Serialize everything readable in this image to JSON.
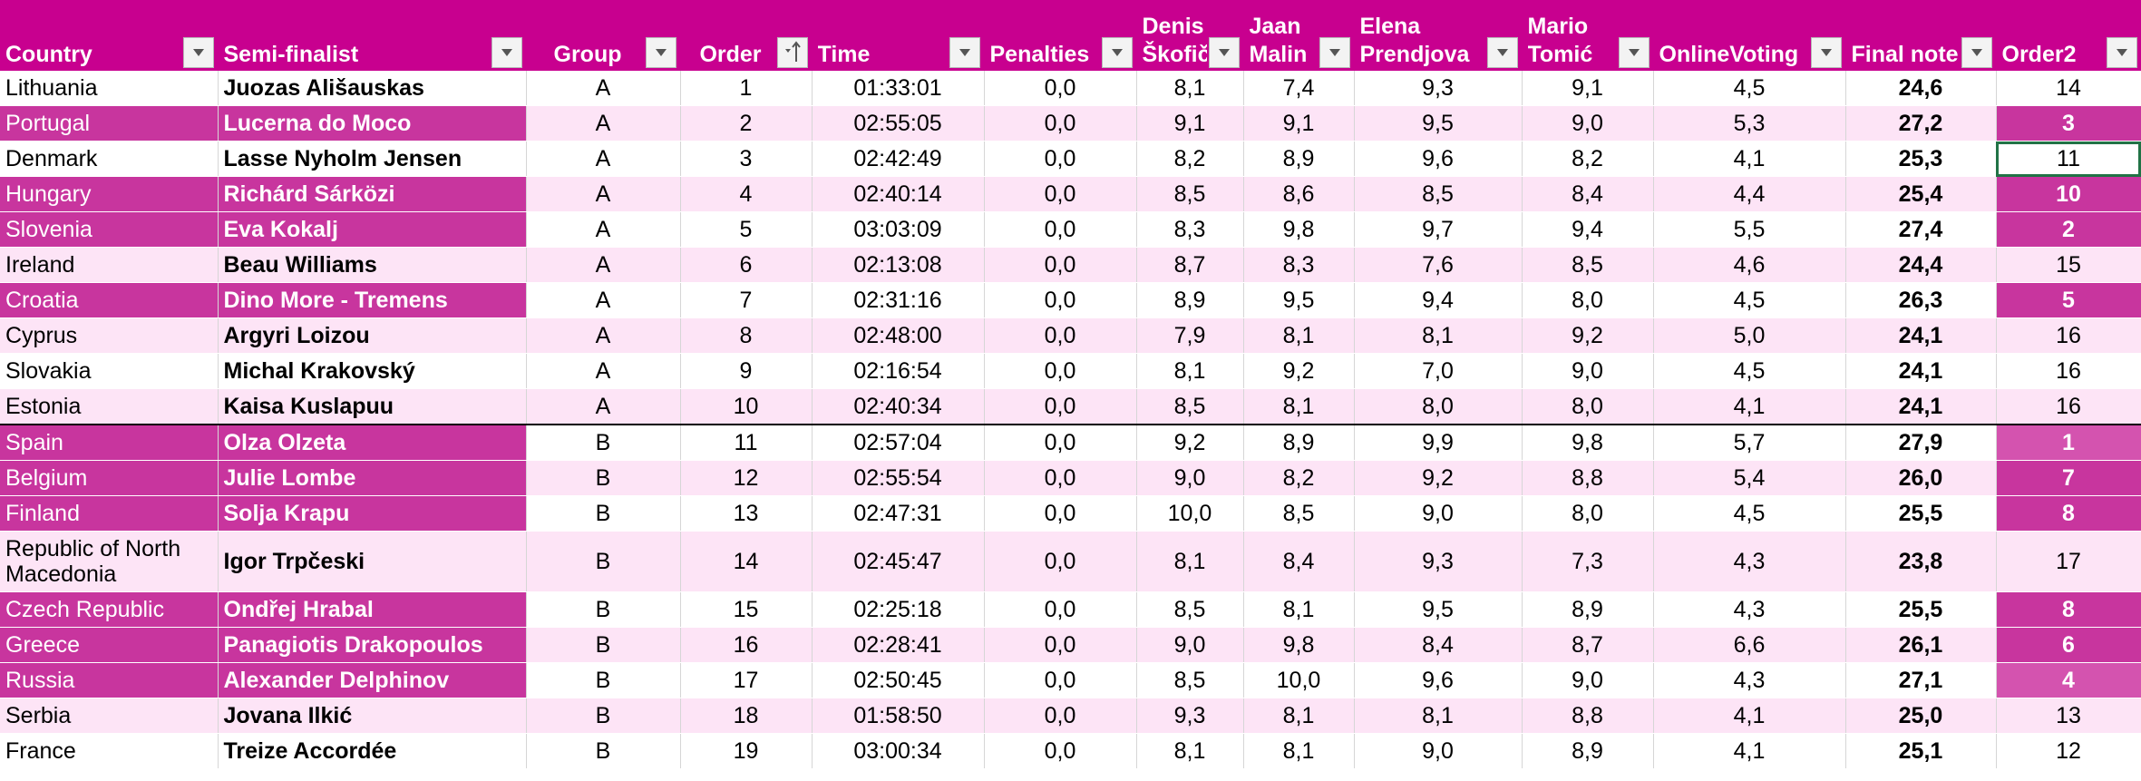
{
  "headers": [
    "Country",
    "Semi-finalist",
    "Group",
    "Order",
    "Time",
    "Penalties",
    "Denis Škofič",
    "Jaan Malin",
    "Elena Prendjova",
    "Mario Tomić",
    "OnlineVoting",
    "Final note",
    "Order2"
  ],
  "colors": {
    "header_bg": "#c8008f",
    "highlight": "#c8359e",
    "pale_row": "#fde4f6",
    "selection": "#217346"
  },
  "icons": {
    "filter": "filter-dropdown-icon",
    "sort": "sort-ascending-icon"
  },
  "rows": [
    {
      "country": "Lithuania",
      "name": "Juozas Ališauskas",
      "group": "A",
      "order": "1",
      "time": "01:33:01",
      "pen": "0,0",
      "j1": "8,1",
      "j2": "7,4",
      "j3": "9,3",
      "j4": "9,1",
      "online": "4,5",
      "final": "24,6",
      "order2": "14"
    },
    {
      "country": "Portugal",
      "name": "Lucerna do Moco",
      "group": "A",
      "order": "2",
      "time": "02:55:05",
      "pen": "0,0",
      "j1": "9,1",
      "j2": "9,1",
      "j3": "9,5",
      "j4": "9,0",
      "online": "5,3",
      "final": "27,2",
      "order2": "3"
    },
    {
      "country": "Denmark",
      "name": "Lasse Nyholm Jensen",
      "group": "A",
      "order": "3",
      "time": "02:42:49",
      "pen": "0,0",
      "j1": "8,2",
      "j2": "8,9",
      "j3": "9,6",
      "j4": "8,2",
      "online": "4,1",
      "final": "25,3",
      "order2": "11"
    },
    {
      "country": "Hungary",
      "name": "Richárd Sárközi",
      "group": "A",
      "order": "4",
      "time": "02:40:14",
      "pen": "0,0",
      "j1": "8,5",
      "j2": "8,6",
      "j3": "8,5",
      "j4": "8,4",
      "online": "4,4",
      "final": "25,4",
      "order2": "10"
    },
    {
      "country": "Slovenia",
      "name": "Eva Kokalj",
      "group": "A",
      "order": "5",
      "time": "03:03:09",
      "pen": "0,0",
      "j1": "8,3",
      "j2": "9,8",
      "j3": "9,7",
      "j4": "9,4",
      "online": "5,5",
      "final": "27,4",
      "order2": "2"
    },
    {
      "country": "Ireland",
      "name": "Beau Williams",
      "group": "A",
      "order": "6",
      "time": "02:13:08",
      "pen": "0,0",
      "j1": "8,7",
      "j2": "8,3",
      "j3": "7,6",
      "j4": "8,5",
      "online": "4,6",
      "final": "24,4",
      "order2": "15"
    },
    {
      "country": "Croatia",
      "name": "Dino More - Tremens",
      "group": "A",
      "order": "7",
      "time": "02:31:16",
      "pen": "0,0",
      "j1": "8,9",
      "j2": "9,5",
      "j3": "9,4",
      "j4": "8,0",
      "online": "4,5",
      "final": "26,3",
      "order2": "5"
    },
    {
      "country": "Cyprus",
      "name": "Argyri Loizou",
      "group": "A",
      "order": "8",
      "time": "02:48:00",
      "pen": "0,0",
      "j1": "7,9",
      "j2": "8,1",
      "j3": "8,1",
      "j4": "9,2",
      "online": "5,0",
      "final": "24,1",
      "order2": "16"
    },
    {
      "country": "Slovakia",
      "name": "Michal Krakovský",
      "group": "A",
      "order": "9",
      "time": "02:16:54",
      "pen": "0,0",
      "j1": "8,1",
      "j2": "9,2",
      "j3": "7,0",
      "j4": "9,0",
      "online": "4,5",
      "final": "24,1",
      "order2": "16"
    },
    {
      "country": "Estonia",
      "name": "Kaisa Kuslapuu",
      "group": "A",
      "order": "10",
      "time": "02:40:34",
      "pen": "0,0",
      "j1": "8,5",
      "j2": "8,1",
      "j3": "8,0",
      "j4": "8,0",
      "online": "4,1",
      "final": "24,1",
      "order2": "16"
    },
    {
      "country": "Spain",
      "name": "Olza Olzeta",
      "group": "B",
      "order": "11",
      "time": "02:57:04",
      "pen": "0,0",
      "j1": "9,2",
      "j2": "8,9",
      "j3": "9,9",
      "j4": "9,8",
      "online": "5,7",
      "final": "27,9",
      "order2": "1"
    },
    {
      "country": "Belgium",
      "name": "Julie Lombe",
      "group": "B",
      "order": "12",
      "time": "02:55:54",
      "pen": "0,0",
      "j1": "9,0",
      "j2": "8,2",
      "j3": "9,2",
      "j4": "8,8",
      "online": "5,4",
      "final": "26,0",
      "order2": "7"
    },
    {
      "country": "Finland",
      "name": "Solja Krapu",
      "group": "B",
      "order": "13",
      "time": "02:47:31",
      "pen": "0,0",
      "j1": "10,0",
      "j2": "8,5",
      "j3": "9,0",
      "j4": "8,0",
      "online": "4,5",
      "final": "25,5",
      "order2": "8"
    },
    {
      "country": "Republic of North Macedonia",
      "name": "Igor Trpčeski",
      "group": "B",
      "order": "14",
      "time": "02:45:47",
      "pen": "0,0",
      "j1": "8,1",
      "j2": "8,4",
      "j3": "9,3",
      "j4": "7,3",
      "online": "4,3",
      "final": "23,8",
      "order2": "17"
    },
    {
      "country": "Czech Republic",
      "name": "Ondřej Hrabal",
      "group": "B",
      "order": "15",
      "time": "02:25:18",
      "pen": "0,0",
      "j1": "8,5",
      "j2": "8,1",
      "j3": "9,5",
      "j4": "8,9",
      "online": "4,3",
      "final": "25,5",
      "order2": "8"
    },
    {
      "country": "Greece",
      "name": "Panagiotis Drakopoulos",
      "group": "B",
      "order": "16",
      "time": "02:28:41",
      "pen": "0,0",
      "j1": "9,0",
      "j2": "9,8",
      "j3": "8,4",
      "j4": "8,7",
      "online": "6,6",
      "final": "26,1",
      "order2": "6"
    },
    {
      "country": "Russia",
      "name": "Alexander Delphinov",
      "group": "B",
      "order": "17",
      "time": "02:50:45",
      "pen": "0,0",
      "j1": "8,5",
      "j2": "10,0",
      "j3": "9,6",
      "j4": "9,0",
      "online": "4,3",
      "final": "27,1",
      "order2": "4"
    },
    {
      "country": "Serbia",
      "name": "Jovana Ilkić",
      "group": "B",
      "order": "18",
      "time": "01:58:50",
      "pen": "0,0",
      "j1": "9,3",
      "j2": "8,1",
      "j3": "8,1",
      "j4": "8,8",
      "online": "4,1",
      "final": "25,0",
      "order2": "13"
    },
    {
      "country": "France",
      "name": "Treize Accordée",
      "group": "B",
      "order": "19",
      "time": "03:00:34",
      "pen": "0,0",
      "j1": "8,1",
      "j2": "8,1",
      "j3": "9,0",
      "j4": "8,9",
      "online": "4,1",
      "final": "25,1",
      "order2": "12"
    }
  ]
}
